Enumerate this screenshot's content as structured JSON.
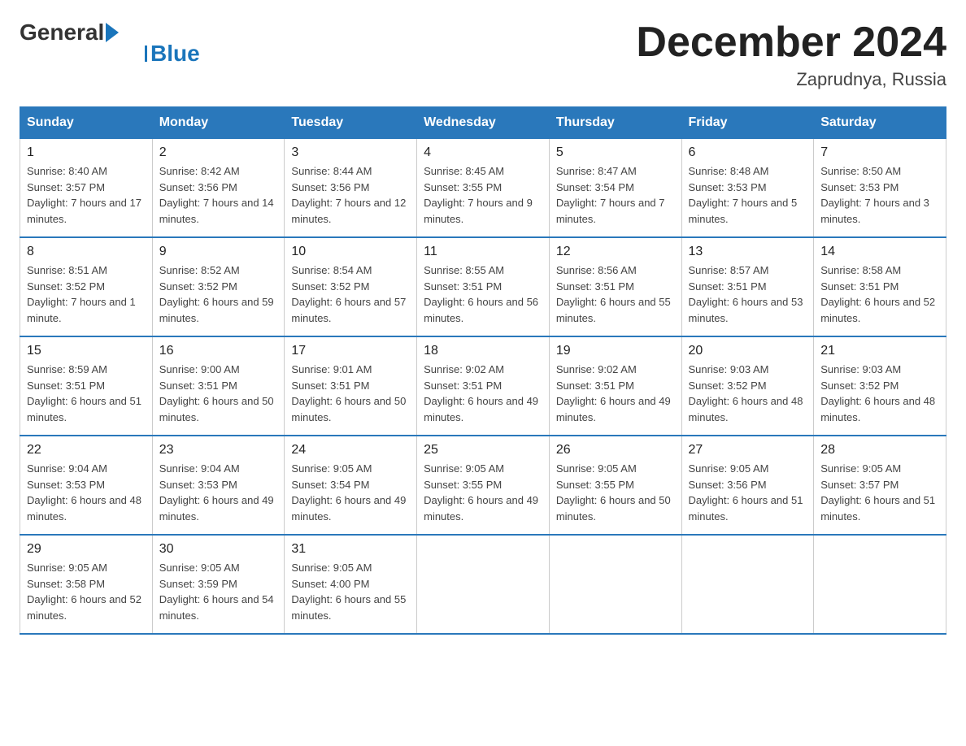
{
  "logo": {
    "general": "General",
    "blue": "Blue"
  },
  "header": {
    "title": "December 2024",
    "location": "Zaprudnya, Russia"
  },
  "days_of_week": [
    "Sunday",
    "Monday",
    "Tuesday",
    "Wednesday",
    "Thursday",
    "Friday",
    "Saturday"
  ],
  "weeks": [
    [
      {
        "day": "1",
        "sunrise": "8:40 AM",
        "sunset": "3:57 PM",
        "daylight": "7 hours and 17 minutes."
      },
      {
        "day": "2",
        "sunrise": "8:42 AM",
        "sunset": "3:56 PM",
        "daylight": "7 hours and 14 minutes."
      },
      {
        "day": "3",
        "sunrise": "8:44 AM",
        "sunset": "3:56 PM",
        "daylight": "7 hours and 12 minutes."
      },
      {
        "day": "4",
        "sunrise": "8:45 AM",
        "sunset": "3:55 PM",
        "daylight": "7 hours and 9 minutes."
      },
      {
        "day": "5",
        "sunrise": "8:47 AM",
        "sunset": "3:54 PM",
        "daylight": "7 hours and 7 minutes."
      },
      {
        "day": "6",
        "sunrise": "8:48 AM",
        "sunset": "3:53 PM",
        "daylight": "7 hours and 5 minutes."
      },
      {
        "day": "7",
        "sunrise": "8:50 AM",
        "sunset": "3:53 PM",
        "daylight": "7 hours and 3 minutes."
      }
    ],
    [
      {
        "day": "8",
        "sunrise": "8:51 AM",
        "sunset": "3:52 PM",
        "daylight": "7 hours and 1 minute."
      },
      {
        "day": "9",
        "sunrise": "8:52 AM",
        "sunset": "3:52 PM",
        "daylight": "6 hours and 59 minutes."
      },
      {
        "day": "10",
        "sunrise": "8:54 AM",
        "sunset": "3:52 PM",
        "daylight": "6 hours and 57 minutes."
      },
      {
        "day": "11",
        "sunrise": "8:55 AM",
        "sunset": "3:51 PM",
        "daylight": "6 hours and 56 minutes."
      },
      {
        "day": "12",
        "sunrise": "8:56 AM",
        "sunset": "3:51 PM",
        "daylight": "6 hours and 55 minutes."
      },
      {
        "day": "13",
        "sunrise": "8:57 AM",
        "sunset": "3:51 PM",
        "daylight": "6 hours and 53 minutes."
      },
      {
        "day": "14",
        "sunrise": "8:58 AM",
        "sunset": "3:51 PM",
        "daylight": "6 hours and 52 minutes."
      }
    ],
    [
      {
        "day": "15",
        "sunrise": "8:59 AM",
        "sunset": "3:51 PM",
        "daylight": "6 hours and 51 minutes."
      },
      {
        "day": "16",
        "sunrise": "9:00 AM",
        "sunset": "3:51 PM",
        "daylight": "6 hours and 50 minutes."
      },
      {
        "day": "17",
        "sunrise": "9:01 AM",
        "sunset": "3:51 PM",
        "daylight": "6 hours and 50 minutes."
      },
      {
        "day": "18",
        "sunrise": "9:02 AM",
        "sunset": "3:51 PM",
        "daylight": "6 hours and 49 minutes."
      },
      {
        "day": "19",
        "sunrise": "9:02 AM",
        "sunset": "3:51 PM",
        "daylight": "6 hours and 49 minutes."
      },
      {
        "day": "20",
        "sunrise": "9:03 AM",
        "sunset": "3:52 PM",
        "daylight": "6 hours and 48 minutes."
      },
      {
        "day": "21",
        "sunrise": "9:03 AM",
        "sunset": "3:52 PM",
        "daylight": "6 hours and 48 minutes."
      }
    ],
    [
      {
        "day": "22",
        "sunrise": "9:04 AM",
        "sunset": "3:53 PM",
        "daylight": "6 hours and 48 minutes."
      },
      {
        "day": "23",
        "sunrise": "9:04 AM",
        "sunset": "3:53 PM",
        "daylight": "6 hours and 49 minutes."
      },
      {
        "day": "24",
        "sunrise": "9:05 AM",
        "sunset": "3:54 PM",
        "daylight": "6 hours and 49 minutes."
      },
      {
        "day": "25",
        "sunrise": "9:05 AM",
        "sunset": "3:55 PM",
        "daylight": "6 hours and 49 minutes."
      },
      {
        "day": "26",
        "sunrise": "9:05 AM",
        "sunset": "3:55 PM",
        "daylight": "6 hours and 50 minutes."
      },
      {
        "day": "27",
        "sunrise": "9:05 AM",
        "sunset": "3:56 PM",
        "daylight": "6 hours and 51 minutes."
      },
      {
        "day": "28",
        "sunrise": "9:05 AM",
        "sunset": "3:57 PM",
        "daylight": "6 hours and 51 minutes."
      }
    ],
    [
      {
        "day": "29",
        "sunrise": "9:05 AM",
        "sunset": "3:58 PM",
        "daylight": "6 hours and 52 minutes."
      },
      {
        "day": "30",
        "sunrise": "9:05 AM",
        "sunset": "3:59 PM",
        "daylight": "6 hours and 54 minutes."
      },
      {
        "day": "31",
        "sunrise": "9:05 AM",
        "sunset": "4:00 PM",
        "daylight": "6 hours and 55 minutes."
      },
      null,
      null,
      null,
      null
    ]
  ]
}
